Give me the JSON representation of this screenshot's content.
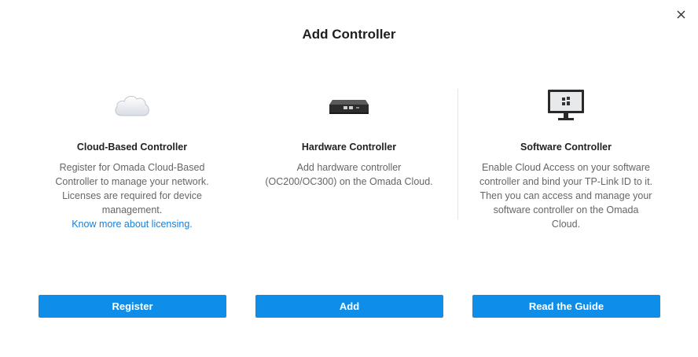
{
  "dialog": {
    "title": "Add Controller",
    "close_icon": "close-icon"
  },
  "options": [
    {
      "icon": "cloud-icon",
      "heading": "Cloud-Based Controller",
      "description": "Register for Omada Cloud-Based Controller to manage your network. Licenses are required for device management.",
      "link": "Know more about licensing.",
      "button": "Register"
    },
    {
      "icon": "hardware-controller-icon",
      "heading": "Hardware Controller",
      "description": "Add hardware controller (OC200/OC300) on the Omada Cloud.",
      "button": "Add"
    },
    {
      "icon": "monitor-icon",
      "heading": "Software Controller",
      "description": "Enable Cloud Access on your software controller and bind your TP-Link ID to it. Then you can access and manage your software controller on the Omada Cloud.",
      "button": "Read the Guide"
    }
  ],
  "colors": {
    "primary_button": "#0f8ee9",
    "link": "#1a7ed6"
  }
}
